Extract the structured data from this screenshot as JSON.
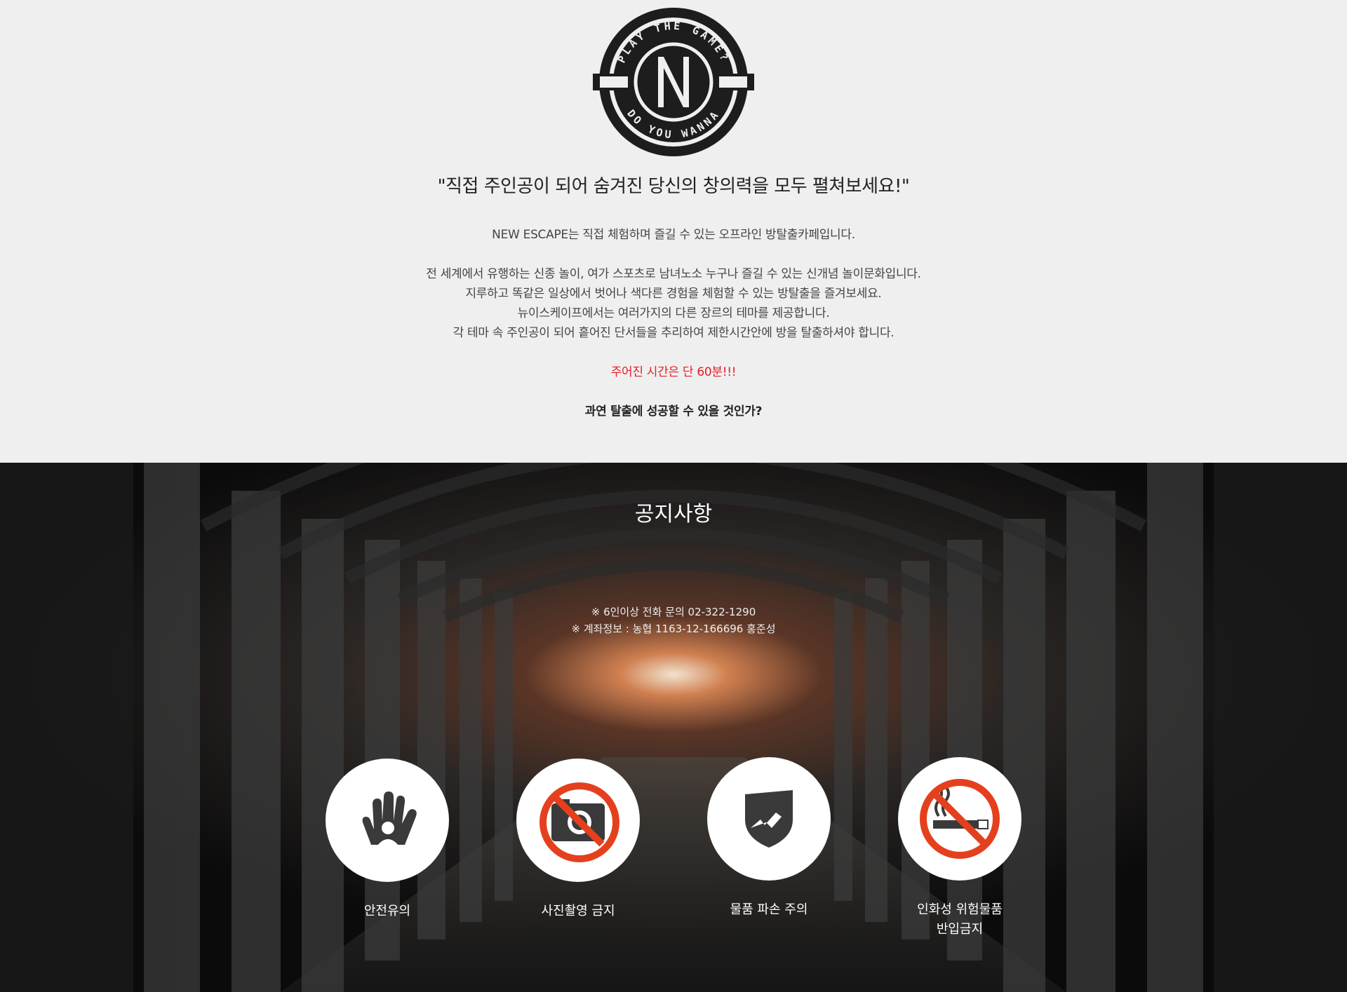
{
  "logo": {
    "ring_text_top": "PLAY THE GAME?",
    "ring_text_bottom": "DO YOU WANNA",
    "letter": "N"
  },
  "intro": {
    "headline": "\"직접 주인공이 되어 숨겨진 당신의 창의력을 모두 펼쳐보세요!\"",
    "line1": "NEW ESCAPE는 직접 체험하며 즐길 수 있는 오프라인 방탈출카페입니다.",
    "line2": "전 세계에서 유행하는 신종 놀이, 여가 스포츠로 남녀노소 누구나 즐길 수 있는 신개념 놀이문화입니다.",
    "line3": "지루하고 똑같은 일상에서 벗어나 색다른 경험을 체험할 수 있는 방탈출을 즐겨보세요.",
    "line4": "뉴이스케이프에서는 여러가지의 다른 장르의 테마를 제공합니다.",
    "line5": "각 테마 속 주인공이 되어 흩어진 단서들을 추리하여 제한시간안에 방을 탈출하셔야 합니다.",
    "highlight": "주어진 시간은 단 60분!!!",
    "closing": "과연 탈출에 성공할 수 있을 것인가?"
  },
  "notice": {
    "title": "공지사항",
    "info1": "※ 6인이상 전화 문의 02-322-1290",
    "info2": "※ 계좌정보 : 농협 1163-12-166696  홍준성",
    "items": [
      {
        "label": "안전유의",
        "icon": "hand-warning-icon"
      },
      {
        "label": "사진촬영 금지",
        "icon": "no-camera-icon"
      },
      {
        "label": "물품 파손 주의",
        "icon": "broken-shield-icon"
      },
      {
        "label_line1": "인화성 위험물품",
        "label_line2": "반입금지",
        "icon": "no-smoking-icon"
      }
    ]
  },
  "colors": {
    "page_bg": "#efefef",
    "accent_red": "#e31e24",
    "prohibition_red": "#e4401e",
    "icon_dark": "#3a3a3a"
  }
}
